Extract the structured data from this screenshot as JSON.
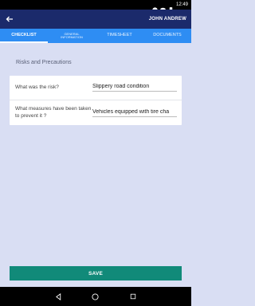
{
  "status_bar": {
    "time": "12:49"
  },
  "header": {
    "user_name": "JOHN ANDREW"
  },
  "tabs": [
    {
      "label": "CHECKLIST",
      "active": true
    },
    {
      "label": "GENERAL INFORMATION",
      "active": false
    },
    {
      "label": "TIMESHEET",
      "active": false
    },
    {
      "label": "DOCUMENTS",
      "active": false
    }
  ],
  "section": {
    "title": "Risks and Precautions"
  },
  "form": {
    "rows": [
      {
        "question": "What was the risk?",
        "answer": "Slippery road condition"
      },
      {
        "question": "What measures have been taken to prevent it ?",
        "answer": "Vehicles equipped with tire cha"
      }
    ]
  },
  "actions": {
    "save_label": "SAVE"
  }
}
